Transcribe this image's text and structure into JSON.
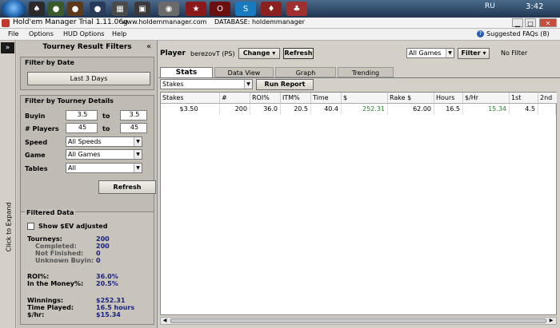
{
  "taskbar": {
    "lang": "RU",
    "time": "3:42"
  },
  "window": {
    "title": "Hold'em Manager Trial 1.11.06g",
    "url": "www.holdemmanager.com",
    "database": "DATABASE: holdemmanager",
    "btn_min": "▁",
    "btn_max": "□",
    "btn_close": "✕"
  },
  "menu": {
    "items": [
      "File",
      "Options",
      "HUD Options",
      "Help"
    ],
    "faq": "Suggested FAQs (8)"
  },
  "sidebar": {
    "expand_btn": "»",
    "expand_text": "Click to Expand"
  },
  "filters": {
    "title": "Tourney Result Filters",
    "collapse": "«",
    "by_date": {
      "title": "Filter by Date",
      "button": "Last 3 Days"
    },
    "by_details": {
      "title": "Filter by Tourney Details",
      "buyin_label": "Buyin",
      "buyin_from": "3.5",
      "buyin_to_label": "to",
      "buyin_to": "3.5",
      "players_label": "# Players",
      "players_from": "45",
      "players_to_label": "to",
      "players_to": "45",
      "speed_label": "Speed",
      "speed_value": "All Speeds",
      "game_label": "Game",
      "game_value": "All Games",
      "tables_label": "Tables",
      "tables_value": "All"
    },
    "refresh": "Refresh",
    "filtered": {
      "title": "Filtered Data",
      "sev_label": "Show $EV adjusted",
      "tourneys_label": "Tourneys:",
      "tourneys": "200",
      "completed_label": "Completed:",
      "completed": "200",
      "not_finished_label": "Not Finished:",
      "not_finished": "0",
      "unknown_label": "Unknown Buyin:",
      "unknown": "0",
      "roi_label": "ROI%:",
      "roi": "36.0%",
      "itm_label": "In the Money%:",
      "itm": "20.5%",
      "winnings_label": "Winnings:",
      "winnings": "$252.31",
      "time_label": "Time Played:",
      "time": "16.5 hours",
      "hr_label": "$/hr:",
      "hr": "$15.34"
    }
  },
  "main": {
    "player_label": "Player",
    "player_name": "berezovT (PS)",
    "change_btn": "Change",
    "refresh_btn": "Refresh",
    "games_select": "All Games",
    "filter_btn": "Filter",
    "no_filter": "No Filter",
    "tabs": [
      "Stats",
      "Data View",
      "Graph",
      "Trending"
    ],
    "group_select": "Stakes",
    "run_report": "Run Report",
    "columns": [
      "Stakes",
      "#",
      "ROI%",
      "ITM%",
      "Time",
      "$",
      "Rake $",
      "Hours",
      "$/Hr",
      "1st",
      "2nd"
    ],
    "rows": [
      [
        "$3.50",
        "200",
        "36.0",
        "20.5",
        "40.4",
        "252.31",
        "62.00",
        "16.5",
        "15.34",
        "4.5",
        ""
      ]
    ],
    "colors": {
      "positive": "#2e7d32"
    }
  }
}
